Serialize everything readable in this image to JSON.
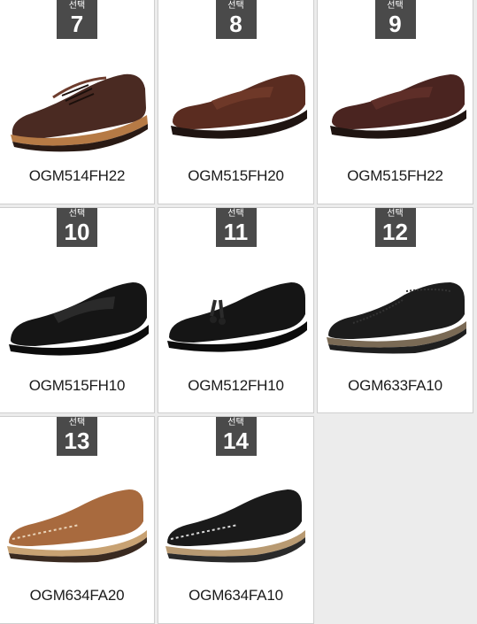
{
  "select_label": "선택",
  "products": [
    {
      "number": "7",
      "code": "OGM514FH22",
      "style": "derby",
      "color": "#4a2a22"
    },
    {
      "number": "8",
      "code": "OGM515FH20",
      "style": "loafer",
      "color": "#5a2c20"
    },
    {
      "number": "9",
      "code": "OGM515FH22",
      "style": "loafer",
      "color": "#4a2420"
    },
    {
      "number": "10",
      "code": "OGM515FH10",
      "style": "loafer",
      "color": "#151515"
    },
    {
      "number": "11",
      "code": "OGM512FH10",
      "style": "tassel",
      "color": "#151515"
    },
    {
      "number": "12",
      "code": "OGM633FA10",
      "style": "brogue",
      "color": "#1c1c1c"
    },
    {
      "number": "13",
      "code": "OGM634FA20",
      "style": "moc",
      "color": "#a86a3e"
    },
    {
      "number": "14",
      "code": "OGM634FA10",
      "style": "moc",
      "color": "#1a1a1a"
    }
  ]
}
